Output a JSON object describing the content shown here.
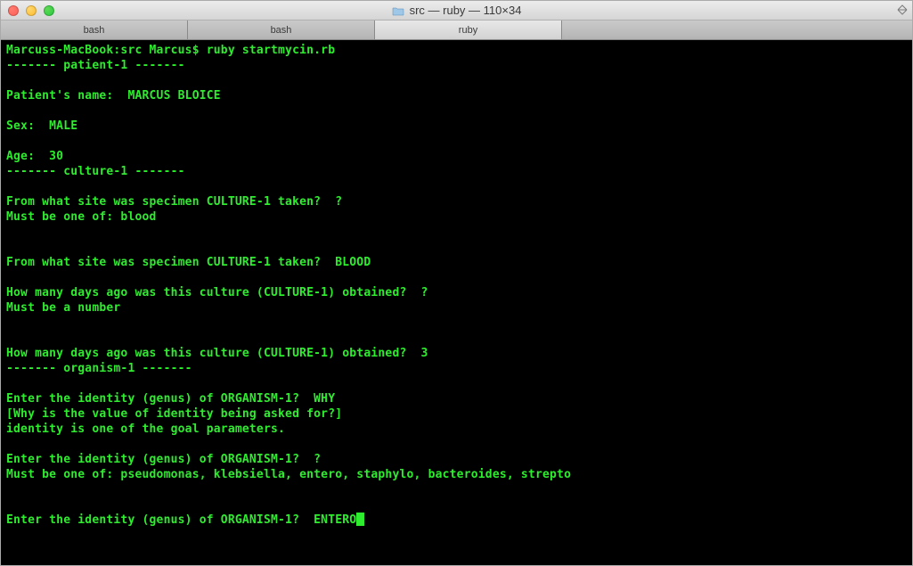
{
  "window": {
    "title": "src — ruby — 110×34"
  },
  "tabs": [
    {
      "label": "bash",
      "active": false
    },
    {
      "label": "bash",
      "active": false
    },
    {
      "label": "ruby",
      "active": true
    }
  ],
  "terminal": {
    "prompt": "Marcuss-MacBook:src Marcus$ ",
    "command": "ruby startmycin.rb",
    "lines": [
      "------- patient-1 -------",
      "",
      "Patient's name:  MARCUS BLOICE",
      "",
      "Sex:  MALE",
      "",
      "Age:  30",
      "------- culture-1 -------",
      "",
      "From what site was specimen CULTURE-1 taken?  ?",
      "Must be one of: blood",
      "",
      "",
      "From what site was specimen CULTURE-1 taken?  BLOOD",
      "",
      "How many days ago was this culture (CULTURE-1) obtained?  ?",
      "Must be a number",
      "",
      "",
      "How many days ago was this culture (CULTURE-1) obtained?  3",
      "------- organism-1 -------",
      "",
      "Enter the identity (genus) of ORGANISM-1?  WHY",
      "[Why is the value of identity being asked for?]",
      "identity is one of the goal parameters.",
      "",
      "Enter the identity (genus) of ORGANISM-1?  ?",
      "Must be one of: pseudomonas, klebsiella, entero, staphylo, bacteroides, strepto",
      "",
      "",
      "Enter the identity (genus) of ORGANISM-1?  ENTERO"
    ]
  }
}
